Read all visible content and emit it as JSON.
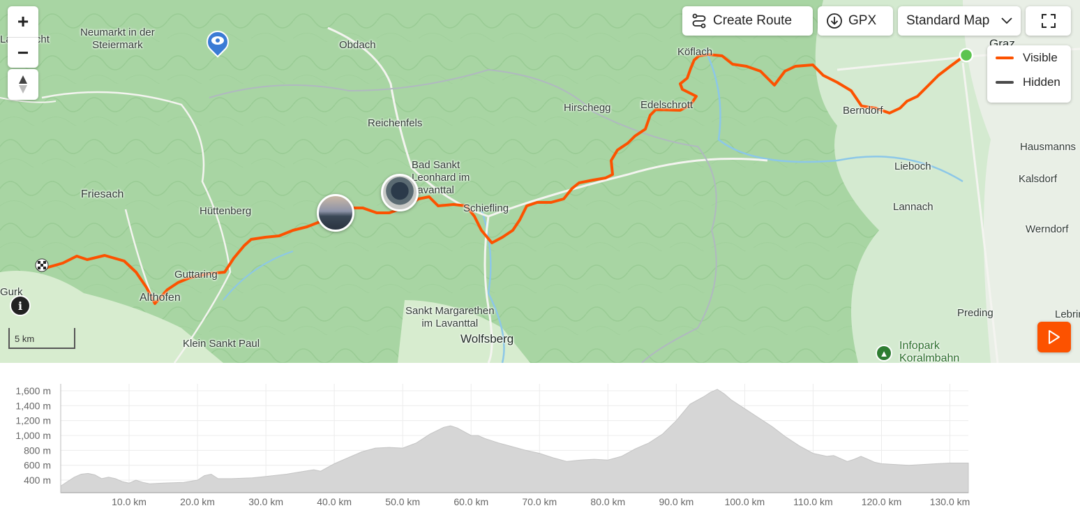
{
  "map": {
    "controls": {
      "zoom_in": "+",
      "zoom_out": "−",
      "create_route_label": "Create Route",
      "gpx_label": "GPX",
      "map_style_label": "Standard Map",
      "scale_label": "5 km"
    },
    "legend": [
      {
        "label": "Visible",
        "color": "#fc5200"
      },
      {
        "label": "Hidden",
        "color": "#4a4a4a"
      }
    ],
    "places": {
      "neumarkt": "Neumarkt in der\nSteiermark",
      "lambrecht": "Lambrecht",
      "obdach": "Obdach",
      "koflach": "Köflach",
      "graz": "Graz",
      "hirschegg": "Hirschegg",
      "edelschrott": "Edelschrott",
      "berndorf": "Berndorf",
      "reichenfels": "Reichenfels",
      "hausmanns": "Hausmanns",
      "bad_sankt": "Bad Sankt\nLeonhard im\nLavanttal",
      "lieboch": "Lieboch",
      "friesach": "Friesach",
      "kalsdorf": "Kalsdorf",
      "schiefling": "Schiefling",
      "huttenberg": "Hüttenberg",
      "lannach": "Lannach",
      "werndorf": "Werndorf",
      "guttaring": "Guttaring",
      "althofen": "Althofen",
      "gurk": "Gurk",
      "sankt_margarethen": "Sankt Margarethen\nim Lavanttal",
      "preding": "Preding",
      "lebring": "Lebring",
      "wolfsberg": "Wolfsberg",
      "klein_sankt_paul": "Klein Sankt Paul",
      "infopark": "Infopark\nKoralmbahn"
    },
    "route_color": "#fc5200",
    "start_color": "#5cc44f"
  },
  "elevation": {
    "fill_color": "#d6d6d6",
    "y_ticks": [
      "1,600 m",
      "1,400 m",
      "1,200 m",
      "1,000 m",
      "800 m",
      "600 m",
      "400 m"
    ],
    "y_values": [
      1600,
      1400,
      1200,
      1000,
      800,
      600,
      400
    ],
    "x_ticks": [
      "10.0 km",
      "20.0 km",
      "30.0 km",
      "40.0 km",
      "50.0 km",
      "60.0 km",
      "70.0 km",
      "80.0 km",
      "90.0 km",
      "100.0 km",
      "110.0 km",
      "120.0 km",
      "130.0 km"
    ],
    "x_values": [
      10,
      20,
      30,
      40,
      50,
      60,
      70,
      80,
      90,
      100,
      110,
      120,
      130
    ],
    "profile": [
      [
        0,
        320
      ],
      [
        1,
        380
      ],
      [
        2,
        440
      ],
      [
        3,
        480
      ],
      [
        4,
        490
      ],
      [
        5,
        470
      ],
      [
        6,
        420
      ],
      [
        7,
        440
      ],
      [
        8,
        420
      ],
      [
        9,
        380
      ],
      [
        10,
        360
      ],
      [
        11,
        400
      ],
      [
        12,
        370
      ],
      [
        13,
        350
      ],
      [
        15,
        360
      ],
      [
        18,
        370
      ],
      [
        20,
        400
      ],
      [
        21,
        460
      ],
      [
        22,
        480
      ],
      [
        23,
        420
      ],
      [
        25,
        420
      ],
      [
        28,
        430
      ],
      [
        30,
        450
      ],
      [
        33,
        480
      ],
      [
        35,
        510
      ],
      [
        37,
        540
      ],
      [
        38,
        520
      ],
      [
        40,
        620
      ],
      [
        42,
        700
      ],
      [
        44,
        780
      ],
      [
        46,
        830
      ],
      [
        48,
        840
      ],
      [
        50,
        830
      ],
      [
        52,
        900
      ],
      [
        54,
        1020
      ],
      [
        56,
        1110
      ],
      [
        57,
        1130
      ],
      [
        58,
        1100
      ],
      [
        59,
        1050
      ],
      [
        60,
        1000
      ],
      [
        61,
        1000
      ],
      [
        62,
        960
      ],
      [
        64,
        900
      ],
      [
        66,
        850
      ],
      [
        68,
        800
      ],
      [
        70,
        760
      ],
      [
        72,
        700
      ],
      [
        74,
        650
      ],
      [
        76,
        670
      ],
      [
        78,
        680
      ],
      [
        80,
        670
      ],
      [
        82,
        720
      ],
      [
        84,
        820
      ],
      [
        86,
        900
      ],
      [
        88,
        1020
      ],
      [
        90,
        1200
      ],
      [
        92,
        1420
      ],
      [
        94,
        1520
      ],
      [
        95,
        1580
      ],
      [
        96,
        1620
      ],
      [
        97,
        1560
      ],
      [
        98,
        1480
      ],
      [
        100,
        1360
      ],
      [
        102,
        1240
      ],
      [
        104,
        1120
      ],
      [
        106,
        980
      ],
      [
        108,
        860
      ],
      [
        110,
        760
      ],
      [
        112,
        720
      ],
      [
        113,
        730
      ],
      [
        114,
        690
      ],
      [
        115,
        650
      ],
      [
        116,
        680
      ],
      [
        117,
        720
      ],
      [
        118,
        680
      ],
      [
        119,
        640
      ],
      [
        120,
        620
      ],
      [
        122,
        610
      ],
      [
        124,
        600
      ],
      [
        126,
        610
      ],
      [
        128,
        620
      ],
      [
        130,
        630
      ],
      [
        132.7,
        630
      ]
    ],
    "max_km": 132.7
  }
}
